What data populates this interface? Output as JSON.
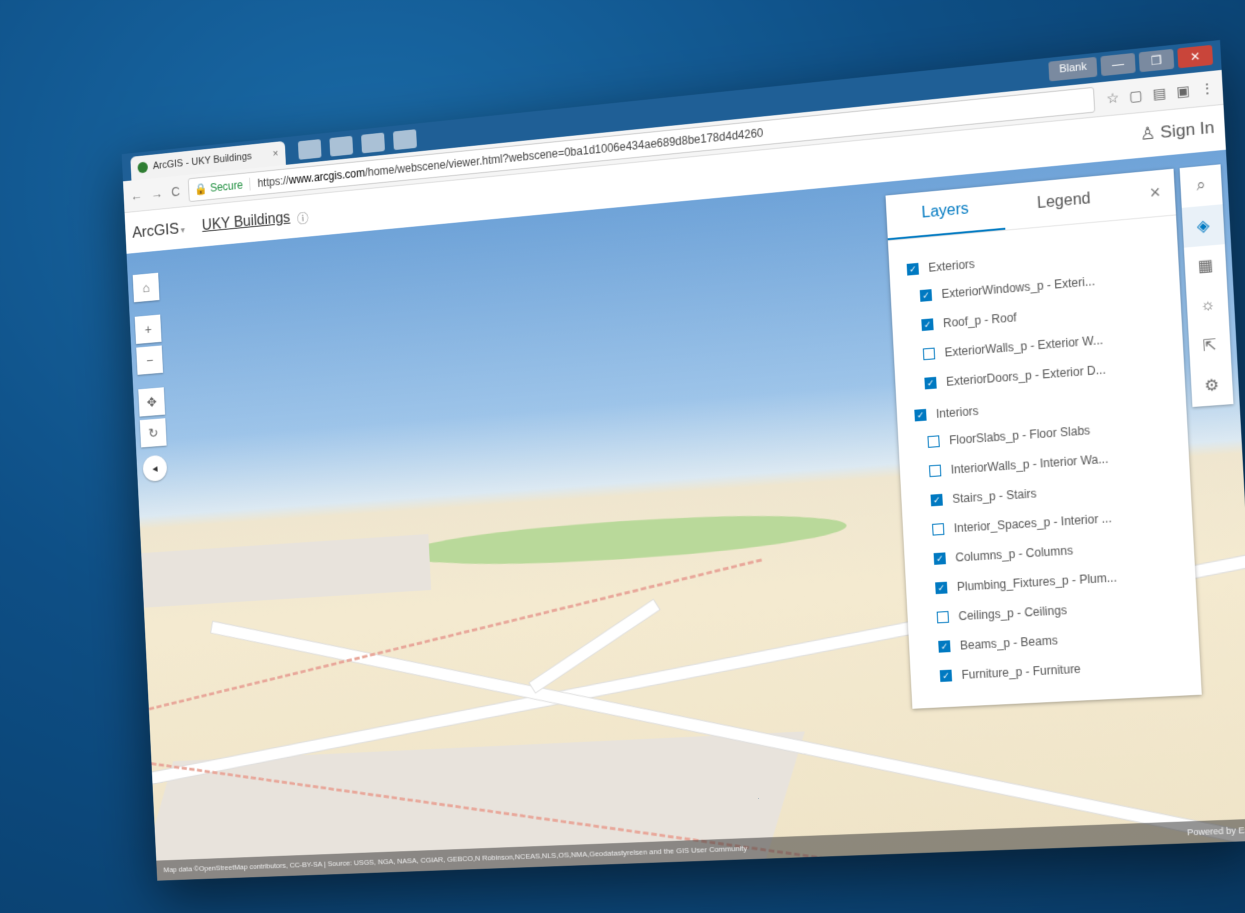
{
  "browser": {
    "tab_title": "ArcGIS - UKY Buildings",
    "tab_close": "×",
    "profile": "Blank",
    "minimize": "—",
    "restore": "❐",
    "close": "✕",
    "secure_label": "Secure",
    "url_prefix": "https://",
    "url_domain": "www.arcgis.com",
    "url_path": "/home/webscene/viewer.html?webscene=0ba1d1006e434ae689d8be178d4d4260"
  },
  "header": {
    "brand": "ArcGIS",
    "scene_title": "UKY Buildings",
    "sign_in": "Sign In"
  },
  "panel": {
    "tab_layers": "Layers",
    "tab_legend": "Legend",
    "close": "×",
    "groups": [
      {
        "label": "Exteriors",
        "checked": true,
        "items": [
          {
            "label": "ExteriorWindows_p - Exteri...",
            "checked": true
          },
          {
            "label": "Roof_p - Roof",
            "checked": true
          },
          {
            "label": "ExteriorWalls_p - Exterior W...",
            "checked": false
          },
          {
            "label": "ExteriorDoors_p - Exterior D...",
            "checked": true
          }
        ]
      },
      {
        "label": "Interiors",
        "checked": true,
        "items": [
          {
            "label": "FloorSlabs_p - Floor Slabs",
            "checked": false
          },
          {
            "label": "InteriorWalls_p - Interior Wa...",
            "checked": false
          },
          {
            "label": "Stairs_p - Stairs",
            "checked": true
          },
          {
            "label": "Interior_Spaces_p - Interior ...",
            "checked": false
          },
          {
            "label": "Columns_p - Columns",
            "checked": true
          },
          {
            "label": "Plumbing_Fixtures_p - Plum...",
            "checked": true
          },
          {
            "label": "Ceilings_p - Ceilings",
            "checked": false
          },
          {
            "label": "Beams_p - Beams",
            "checked": true
          },
          {
            "label": "Furniture_p - Furniture",
            "checked": true
          }
        ]
      }
    ]
  },
  "map": {
    "attribution": "Map data ©OpenStreetMap contributors, CC-BY-SA | Source: USGS, NGA, NASA, CGIAR, GEBCO,N Robinson,NCEAS,NLS,OS,NMA,Geodatastyrelsen and the GIS User Community",
    "powered_by": "Powered by Esri"
  },
  "icons": {
    "home": "⌂",
    "zoom_in": "+",
    "zoom_out": "−",
    "pan": "✥",
    "rotate": "↻",
    "compass": "◂",
    "search": "⌕",
    "layers": "◈",
    "basemap": "▦",
    "daylight": "☼",
    "share": "⇱",
    "settings": "⚙",
    "star": "☆",
    "signin": "♙"
  }
}
